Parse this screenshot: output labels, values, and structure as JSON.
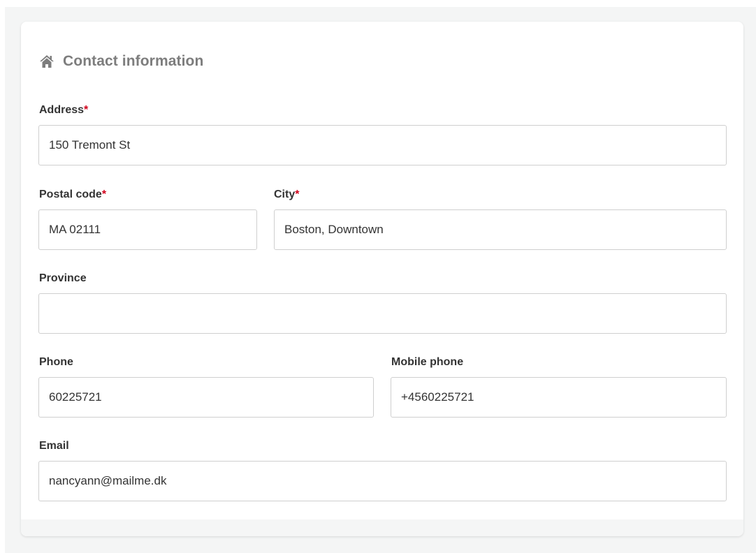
{
  "card": {
    "title": "Contact information",
    "icon": "home-icon"
  },
  "fields": {
    "address": {
      "label": "Address",
      "required_mark": "*",
      "value": "150 Tremont St",
      "placeholder": ""
    },
    "postal_code": {
      "label": "Postal code",
      "required_mark": "*",
      "value": "MA 02111",
      "placeholder": ""
    },
    "city": {
      "label": "City",
      "required_mark": "*",
      "value": "Boston, Downtown",
      "placeholder": ""
    },
    "province": {
      "label": "Province",
      "value": "",
      "placeholder": ""
    },
    "phone": {
      "label": "Phone",
      "value": "60225721",
      "placeholder": ""
    },
    "mobile_phone": {
      "label": "Mobile phone",
      "value": "+4560225721",
      "placeholder": ""
    },
    "email": {
      "label": "Email",
      "value": "nancyann@mailme.dk",
      "placeholder": ""
    }
  },
  "colors": {
    "required": "#d0021b",
    "title": "#7d7d7d",
    "label": "#333333",
    "input_border": "#cfcfcf",
    "background": "#f4f5f5"
  }
}
